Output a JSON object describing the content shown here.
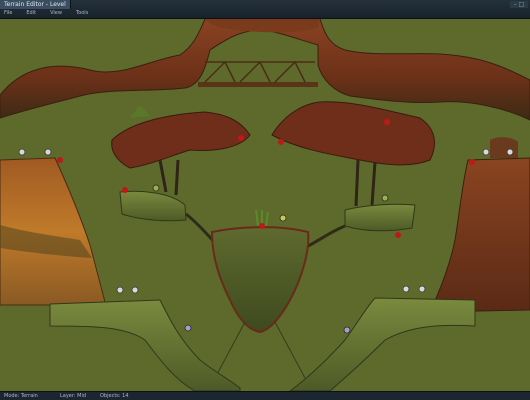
{
  "window": {
    "app_tab": "Terrain Editor - Level",
    "menu": [
      "File",
      "Edit",
      "View",
      "Tools"
    ],
    "control": "– □"
  },
  "status": {
    "left": "Mode: Terrain",
    "middle": "Layer: Mid",
    "right": "Objects: 14"
  },
  "colors": {
    "sky": "#5d6a2c",
    "rock": "#7b3a1e",
    "rock_dark": "#4f2a16",
    "grass": "#6b7a36",
    "marker_red": "#c01818"
  },
  "scene": {
    "type": "2D level editor viewport",
    "objects": [
      "rock-bridge",
      "floating-island-left",
      "floating-island-right",
      "central-bowl-island",
      "ledge-left",
      "ledge-right",
      "spawn-markers",
      "pickups"
    ]
  }
}
